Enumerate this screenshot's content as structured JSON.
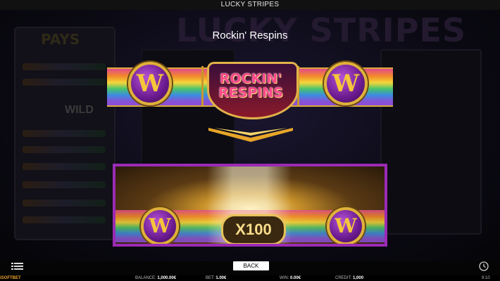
{
  "window": {
    "title": "LUCKY STRIPES"
  },
  "background": {
    "game_title": "LUCKY STRIPES",
    "paytable_title": "PAYS",
    "wild_label": "WILD"
  },
  "popup": {
    "title": "Rockin' Respins",
    "logo_line1": "ROCKIN'",
    "logo_line2": "RESPINS",
    "coin_letter": "W",
    "multiplier": "X100"
  },
  "bottom": {
    "back_label": "BACK"
  },
  "status": {
    "brand": "iSOFTBET",
    "balance_label": "BALANCE:",
    "balance_value": "1,000.00€",
    "bet_label": "BET:",
    "bet_value": "1.00€",
    "win_label": "WIN:",
    "win_value": "0.00€",
    "credit_label": "CREDIT:",
    "credit_value": "1,000",
    "time": "9:10"
  },
  "colors": {
    "accent_purple": "#9b2bb5",
    "gold": "#e0b13a",
    "brand_orange": "#e89f2a"
  }
}
